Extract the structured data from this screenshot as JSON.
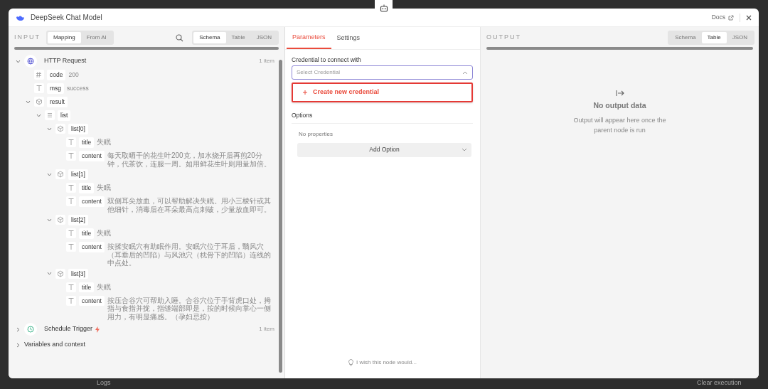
{
  "window": {
    "title": "DeepSeek Chat Model",
    "docs_link": "Docs"
  },
  "input": {
    "label": "INPUT",
    "mode_tabs": [
      {
        "label": "Mapping",
        "selected": true
      },
      {
        "label": "From AI",
        "selected": false
      }
    ],
    "view_tabs": [
      {
        "label": "Schema",
        "selected": true
      },
      {
        "label": "Table",
        "selected": false
      },
      {
        "label": "JSON",
        "selected": false
      }
    ],
    "sections": [
      {
        "name": "HTTP Request",
        "kind": "http",
        "expanded": true,
        "count": "1 item",
        "fields": [
          {
            "key": "code",
            "kind": "number",
            "value": "200"
          },
          {
            "key": "msg",
            "kind": "string",
            "value": "success"
          },
          {
            "key": "result",
            "kind": "object",
            "expanded": true,
            "children": [
              {
                "key": "list",
                "kind": "array",
                "expanded": true,
                "children": [
                  {
                    "key": "list[0]",
                    "kind": "object",
                    "expanded": true,
                    "children": [
                      {
                        "key": "title",
                        "kind": "string",
                        "value": "失眠"
                      },
                      {
                        "key": "content",
                        "kind": "string",
                        "value": "每天取晒干的花生叶200克，加水烧开后再煎20分钟，代茶饮，连服一周。如用鲜花生叶则用量加倍。"
                      }
                    ]
                  },
                  {
                    "key": "list[1]",
                    "kind": "object",
                    "expanded": true,
                    "children": [
                      {
                        "key": "title",
                        "kind": "string",
                        "value": "失眠"
                      },
                      {
                        "key": "content",
                        "kind": "string",
                        "value": "双侧耳尖放血，可以帮助解决失眠。用小三棱针或其他细针，消毒后在耳朵最高点刺破，少量放血即可。"
                      }
                    ]
                  },
                  {
                    "key": "list[2]",
                    "kind": "object",
                    "expanded": true,
                    "children": [
                      {
                        "key": "title",
                        "kind": "string",
                        "value": "失眠"
                      },
                      {
                        "key": "content",
                        "kind": "string",
                        "value": "按揉安眠穴有助眠作用。安眠穴位于耳后，翳风穴（耳垂后的凹陷）与风池穴（枕骨下的凹陷）连线的中点处。"
                      }
                    ]
                  },
                  {
                    "key": "list[3]",
                    "kind": "object",
                    "expanded": true,
                    "children": [
                      {
                        "key": "title",
                        "kind": "string",
                        "value": "失眠"
                      },
                      {
                        "key": "content",
                        "kind": "string",
                        "value": "按压合谷穴可帮助入睡。合谷穴位于手背虎口处，拇指与食指并拢，指缝端部即是，按的时候向掌心一侧用力，有明显痛感。（孕妇忌按）"
                      }
                    ]
                  }
                ]
              }
            ]
          }
        ]
      },
      {
        "name": "Schedule Trigger",
        "kind": "trigger",
        "expanded": false,
        "count": "1 item"
      },
      {
        "name": "Variables and context",
        "kind": "plain",
        "expanded": false
      }
    ]
  },
  "parameters": {
    "tabs": [
      {
        "label": "Parameters",
        "selected": true
      },
      {
        "label": "Settings",
        "selected": false
      }
    ],
    "credential_label": "Credential to connect with",
    "credential_select": {
      "placeholder": "Select Credential",
      "expanded": true
    },
    "create_credential": "Create new credential",
    "options_heading": "Options",
    "no_properties": "No properties",
    "add_option": "Add Option",
    "feedback": "I wish this node would..."
  },
  "output": {
    "label": "OUTPUT",
    "view_tabs": [
      {
        "label": "Schema",
        "selected": false
      },
      {
        "label": "Table",
        "selected": true
      },
      {
        "label": "JSON",
        "selected": false
      }
    ],
    "empty_title": "No output data",
    "empty_text": "Output will appear here once the parent node is run"
  },
  "background": {
    "logs": "Logs",
    "clear_execution": "Clear execution"
  }
}
